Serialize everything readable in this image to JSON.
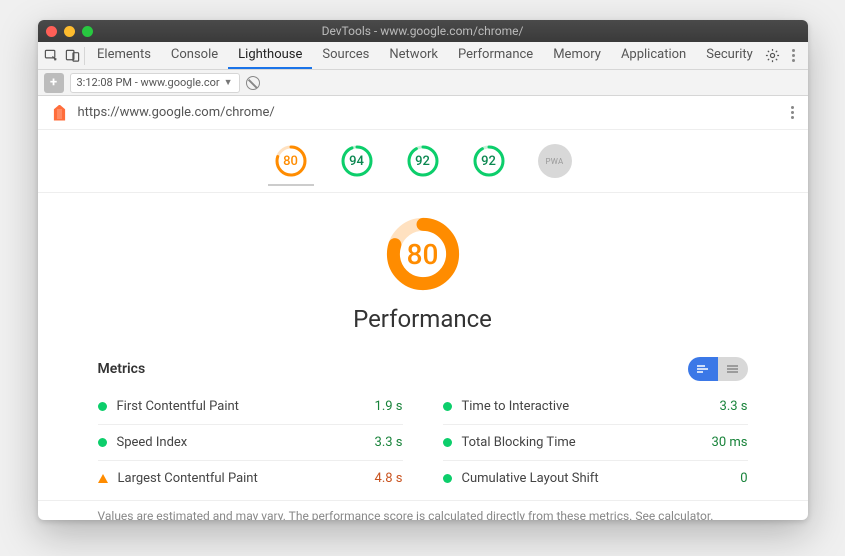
{
  "window": {
    "title": "DevTools - www.google.com/chrome/"
  },
  "tabs": {
    "items": [
      "Elements",
      "Console",
      "Lighthouse",
      "Sources",
      "Network",
      "Performance",
      "Memory",
      "Application",
      "Security"
    ],
    "active": "Lighthouse"
  },
  "subbar": {
    "dropdown": "3:12:08 PM - www.google.cor"
  },
  "urlrow": {
    "url": "https://www.google.com/chrome/"
  },
  "gauges": [
    {
      "score": 80,
      "color": "orange",
      "selected": true
    },
    {
      "score": 94,
      "color": "green"
    },
    {
      "score": 92,
      "color": "green"
    },
    {
      "score": 92,
      "color": "green"
    }
  ],
  "pwa_label": "PWA",
  "hero": {
    "score": 80,
    "title": "Performance"
  },
  "metrics_header": "Metrics",
  "metrics": [
    {
      "name": "First Contentful Paint",
      "value": "1.9 s",
      "status": "good",
      "vclass": "v-green"
    },
    {
      "name": "Time to Interactive",
      "value": "3.3 s",
      "status": "good",
      "vclass": "v-green"
    },
    {
      "name": "Speed Index",
      "value": "3.3 s",
      "status": "good",
      "vclass": "v-green"
    },
    {
      "name": "Total Blocking Time",
      "value": "30 ms",
      "status": "good",
      "vclass": "v-green"
    },
    {
      "name": "Largest Contentful Paint",
      "value": "4.8 s",
      "status": "warn",
      "vclass": "v-orange"
    },
    {
      "name": "Cumulative Layout Shift",
      "value": "0",
      "status": "good",
      "vclass": "v-green"
    }
  ],
  "disclaimer": {
    "pre": "Values are estimated and may vary. The ",
    "link1": "performance score is calculated",
    "mid": " directly from these metrics. ",
    "link2": "See calculator."
  }
}
